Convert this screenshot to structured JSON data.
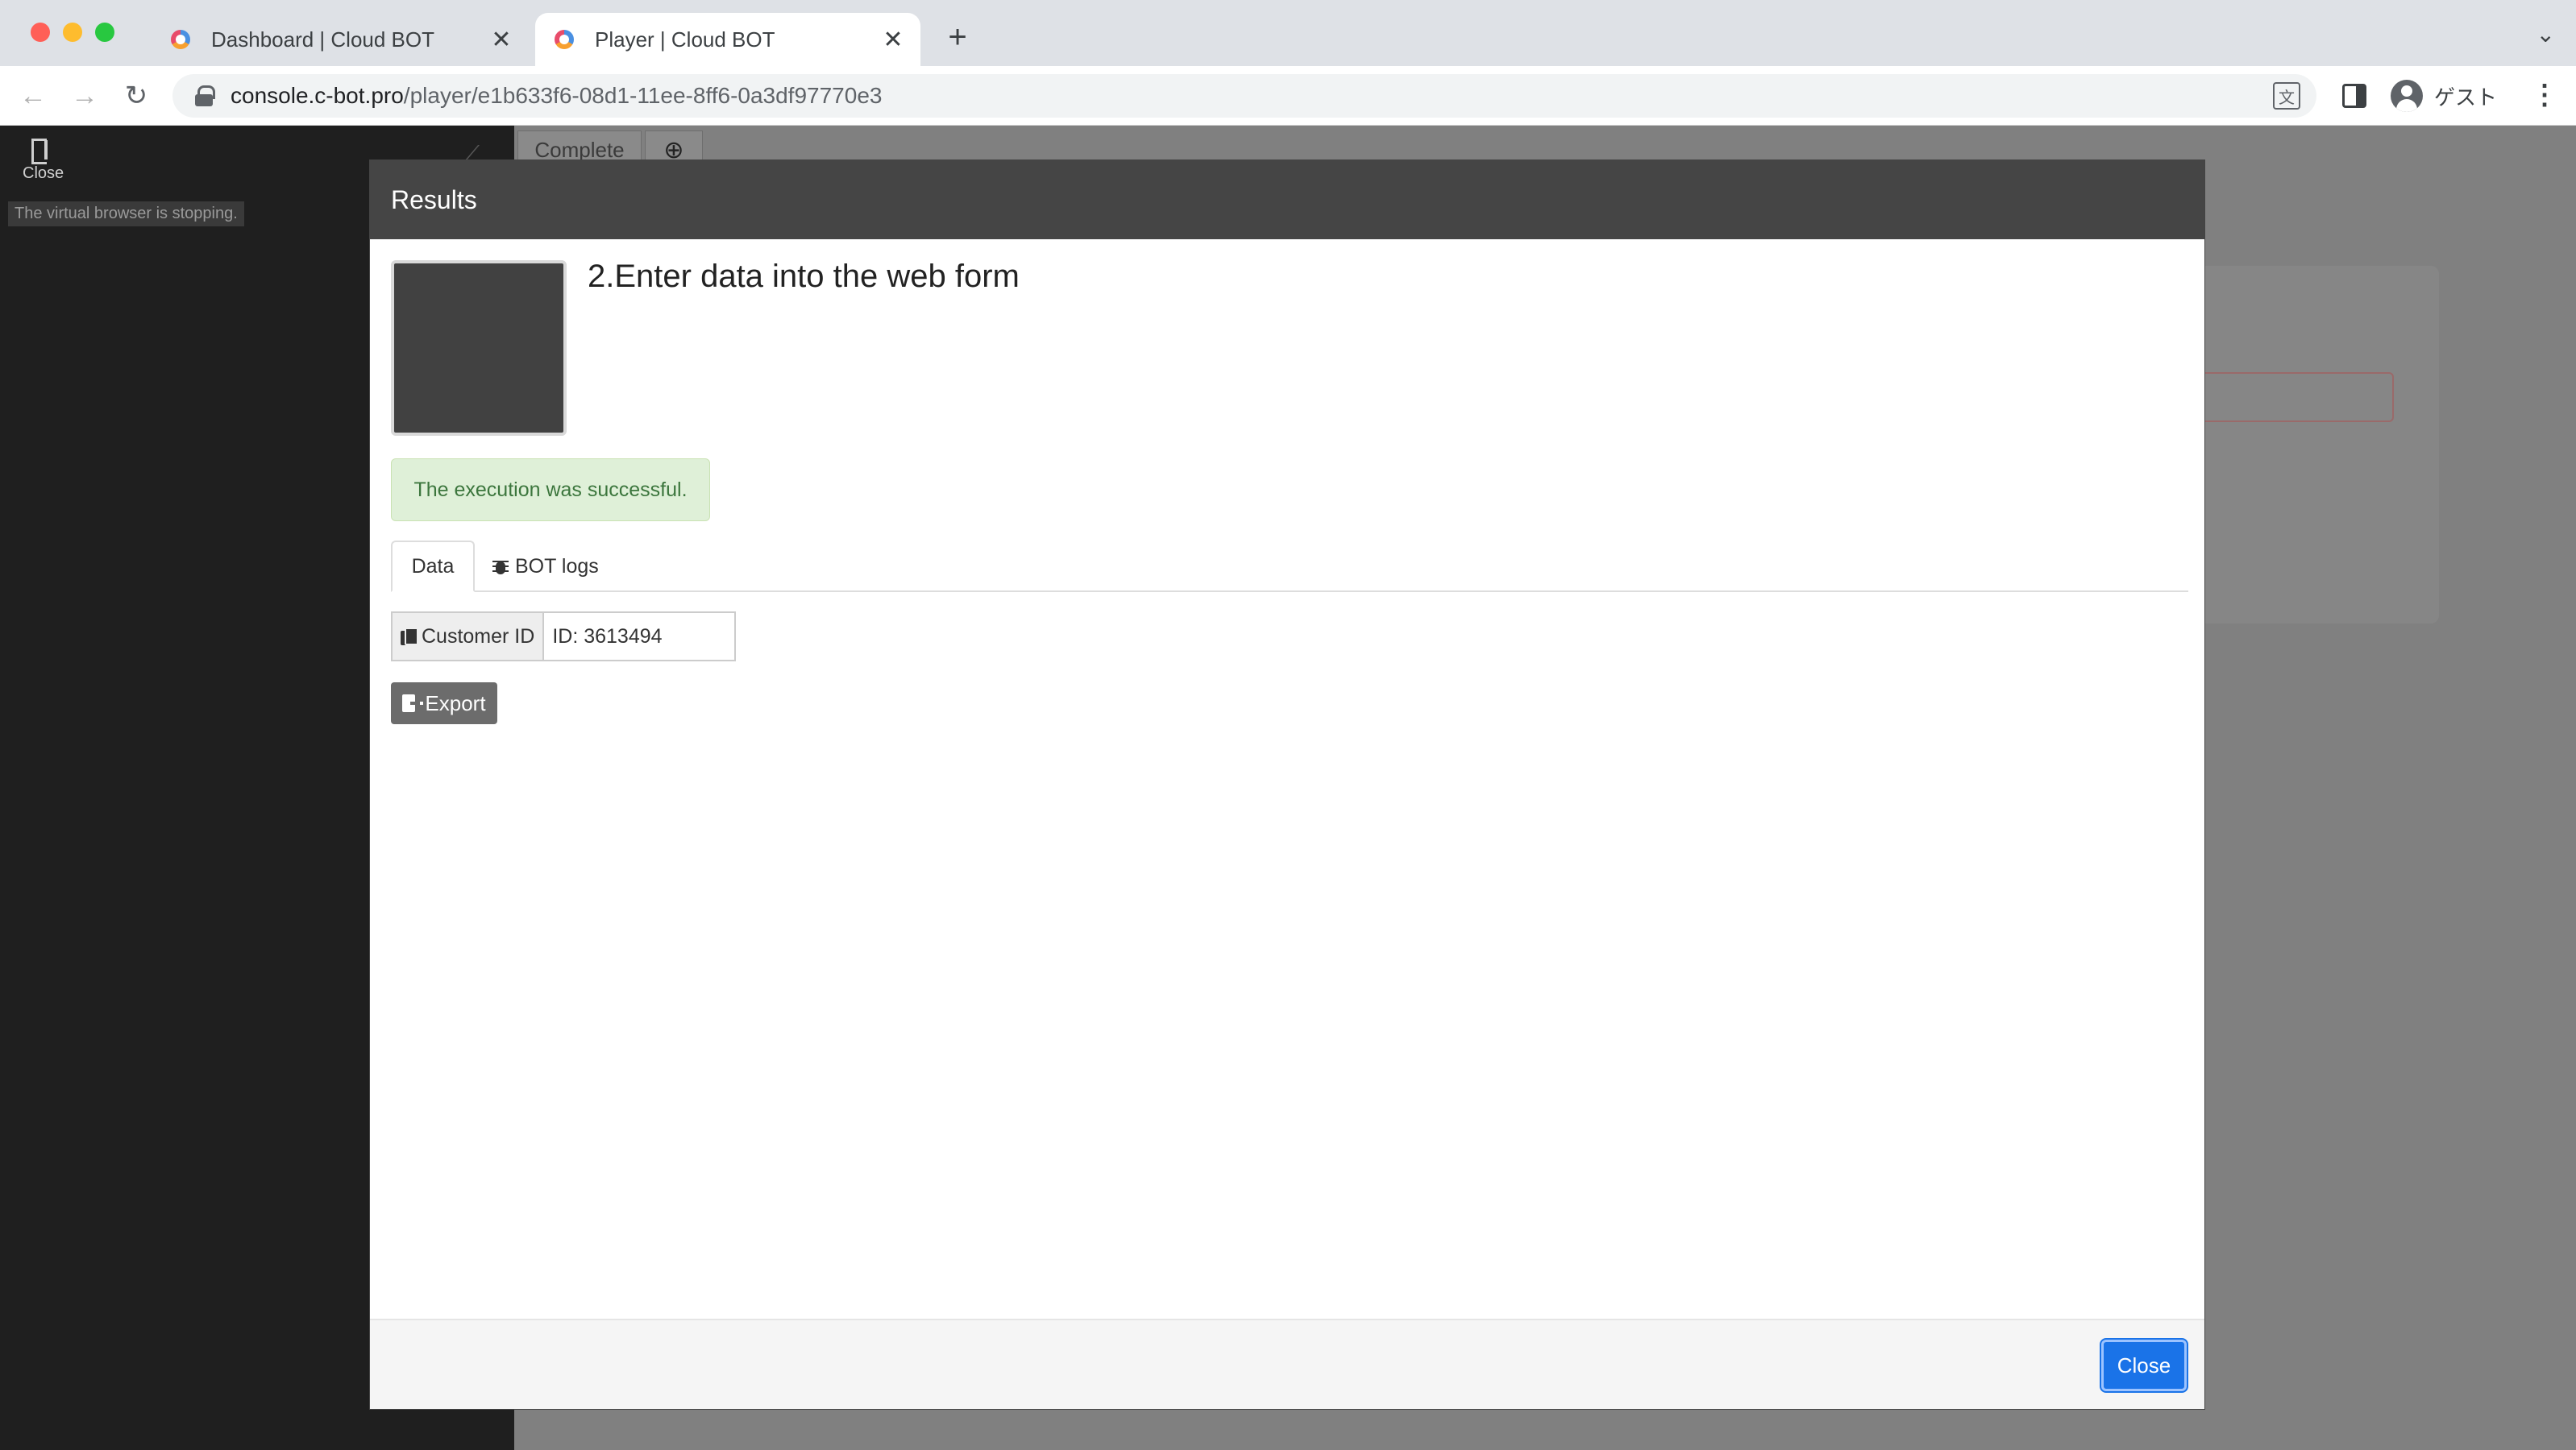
{
  "browser": {
    "tabs": [
      {
        "title": "Dashboard | Cloud BOT",
        "active": false
      },
      {
        "title": "Player | Cloud BOT",
        "active": true
      }
    ],
    "new_tab_symbol": "+",
    "tab_close_symbol": "✕",
    "url_domain": "console.c-bot.pro",
    "url_path": "/player/e1b633f6-08d1-11ee-8ff6-0a3df97770e3",
    "profile_label": "ゲスト",
    "icons": [
      "back-icon",
      "forward-icon",
      "reload-icon",
      "lock-icon",
      "translate-icon",
      "side-panel-icon",
      "avatar-icon",
      "more-icon",
      "tab-search-icon"
    ]
  },
  "player": {
    "close_label": "Close",
    "status_text": "The virtual browser is stopping.",
    "tab_label": "Complete",
    "add_tab_symbol": "⊕"
  },
  "modal": {
    "title": "Results",
    "step_title": "2.Enter data into the web form",
    "success_message": "The execution was successful.",
    "tabs": [
      {
        "label": "Data",
        "active": true
      },
      {
        "label": "BOT logs",
        "active": false,
        "icon": "bug-icon"
      }
    ],
    "data_fields": [
      {
        "label": "Customer ID",
        "value": "ID: 3613494",
        "icon": "copy-icon"
      }
    ],
    "export_label": "Export",
    "close_button_label": "Close",
    "colors": {
      "header_bg": "#454545",
      "success_bg": "#dff0d8",
      "success_text": "#3c763d",
      "primary_button": "#1a73e8",
      "export_button": "#6c6c6c"
    }
  }
}
